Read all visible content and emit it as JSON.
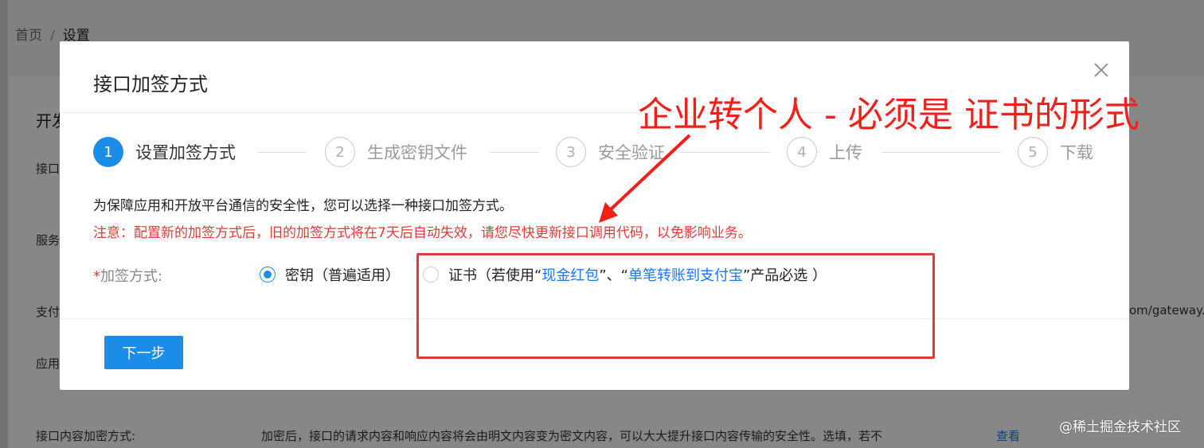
{
  "breadcrumb": {
    "home": "首页",
    "separator": "/",
    "current": "设置"
  },
  "background": {
    "section_title_partial": "开发",
    "row_labels": [
      "接口",
      "服务",
      "支付",
      "应用"
    ],
    "gateway_fragment": "om/gateway.c",
    "encrypt_label": "接口内容加密方式:",
    "encrypt_desc": "加密后，接口的请求内容和响应内容将会由明文内容变为密文内容，可以大大提升接口内容传输的安全性。选填，若不",
    "view_link": "查看"
  },
  "modal": {
    "title": "接口加签方式",
    "close_symbol": "×",
    "steps": [
      {
        "number": "1",
        "label": "设置加签方式",
        "state": "active"
      },
      {
        "number": "2",
        "label": "生成密钥文件",
        "state": "idle"
      },
      {
        "number": "3",
        "label": "安全验证",
        "state": "idle"
      },
      {
        "number": "4",
        "label": "上传",
        "state": "idle"
      },
      {
        "number": "5",
        "label": "下载",
        "state": "idle"
      }
    ],
    "info_text": "为保障应用和开放平台通信的安全性，您可以选择一种接口加签方式。",
    "warning_text": "注意：配置新的加签方式后，旧的加签方式将在7天后自动失效，请您尽快更新接口调用代码，以免影响业务。",
    "form": {
      "label_star": "*",
      "label": "加签方式:",
      "option_key": {
        "label": "密钥（普遍适用）",
        "checked": true
      },
      "option_cert": {
        "prefix": "证书（若使用“",
        "link1": "现金红包",
        "middle": "”、“",
        "link2": "单笔转账到支付宝",
        "suffix": "”产品必选 ）",
        "checked": false
      }
    },
    "next_button": "下一步"
  },
  "annotation": {
    "text": "企业转个人 - 必须是 证书的形式",
    "color": "#f0201b"
  },
  "watermark": "@稀土掘金技术社区",
  "colors": {
    "primary": "#1b8ce8",
    "link": "#1677ff",
    "warning": "#e53935"
  }
}
